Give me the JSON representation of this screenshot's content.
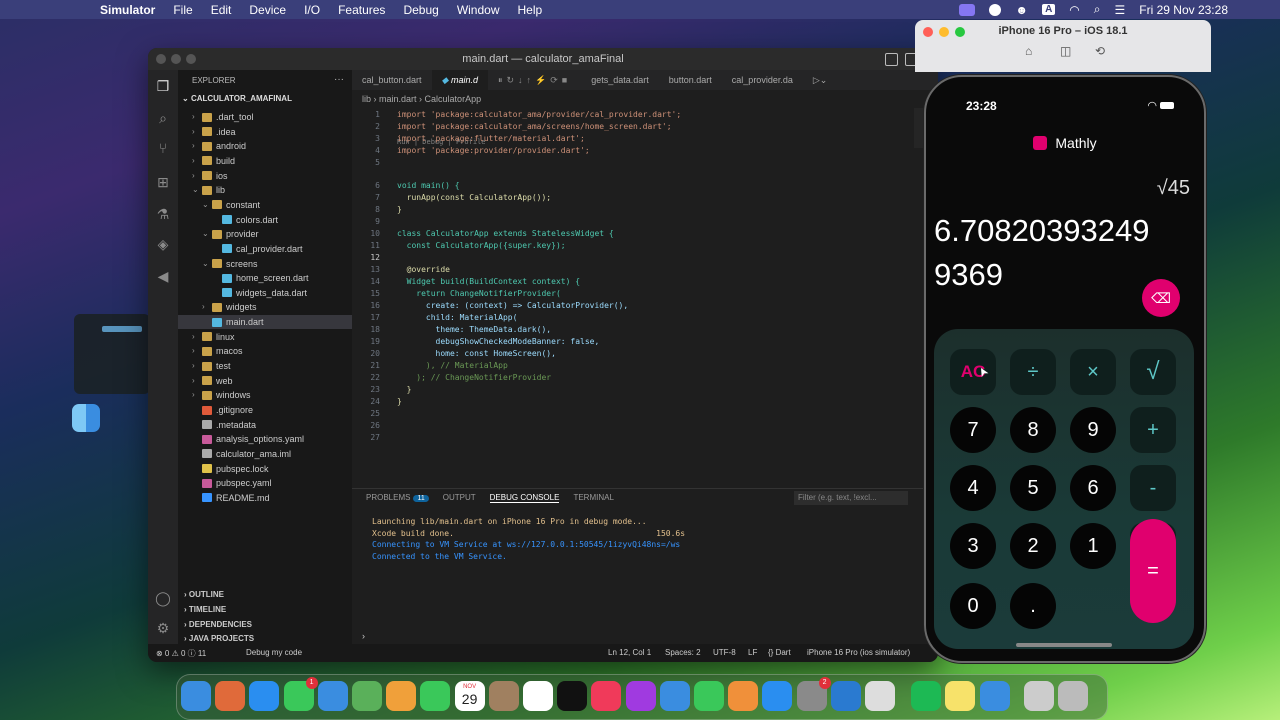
{
  "menubar": {
    "app": "Simulator",
    "items": [
      "File",
      "Edit",
      "Device",
      "I/O",
      "Features",
      "Debug",
      "Window",
      "Help"
    ],
    "datetime": "Fri 29 Nov  23:28",
    "input_source": "A"
  },
  "vscode": {
    "title": "main.dart — calculator_amaFinal",
    "explorer_label": "EXPLORER",
    "root": "CALCULATOR_AMAFINAL",
    "tree": [
      {
        "label": ".dart_tool",
        "type": "folder",
        "depth": 1,
        "open": false
      },
      {
        "label": ".idea",
        "type": "folder",
        "depth": 1,
        "open": false
      },
      {
        "label": "android",
        "type": "folder",
        "depth": 1,
        "open": false
      },
      {
        "label": "build",
        "type": "folder",
        "depth": 1,
        "open": false
      },
      {
        "label": "ios",
        "type": "folder",
        "depth": 1,
        "open": false
      },
      {
        "label": "lib",
        "type": "folder",
        "depth": 1,
        "open": true
      },
      {
        "label": "constant",
        "type": "folder",
        "depth": 2,
        "open": true
      },
      {
        "label": "colors.dart",
        "type": "dart",
        "depth": 3
      },
      {
        "label": "provider",
        "type": "folder",
        "depth": 2,
        "open": true
      },
      {
        "label": "cal_provider.dart",
        "type": "dart",
        "depth": 3
      },
      {
        "label": "screens",
        "type": "folder",
        "depth": 2,
        "open": true
      },
      {
        "label": "home_screen.dart",
        "type": "dart",
        "depth": 3
      },
      {
        "label": "widgets_data.dart",
        "type": "dart",
        "depth": 3
      },
      {
        "label": "widgets",
        "type": "folder",
        "depth": 2,
        "open": false
      },
      {
        "label": "main.dart",
        "type": "dart",
        "depth": 2,
        "selected": true
      },
      {
        "label": "linux",
        "type": "folder",
        "depth": 1,
        "open": false
      },
      {
        "label": "macos",
        "type": "folder",
        "depth": 1,
        "open": false
      },
      {
        "label": "test",
        "type": "folder",
        "depth": 1,
        "open": false
      },
      {
        "label": "web",
        "type": "folder",
        "depth": 1,
        "open": false
      },
      {
        "label": "windows",
        "type": "folder",
        "depth": 1,
        "open": false
      },
      {
        "label": ".gitignore",
        "type": "git",
        "depth": 1
      },
      {
        "label": ".metadata",
        "type": "file",
        "depth": 1
      },
      {
        "label": "analysis_options.yaml",
        "type": "yaml",
        "depth": 1
      },
      {
        "label": "calculator_ama.iml",
        "type": "file",
        "depth": 1
      },
      {
        "label": "pubspec.lock",
        "type": "lock",
        "depth": 1
      },
      {
        "label": "pubspec.yaml",
        "type": "yaml",
        "depth": 1
      },
      {
        "label": "README.md",
        "type": "info",
        "depth": 1
      }
    ],
    "outline_sections": [
      "OUTLINE",
      "TIMELINE",
      "DEPENDENCIES",
      "JAVA PROJECTS"
    ],
    "tabs": [
      "cal_button.dart",
      "main.d",
      "gets_data.dart",
      "button.dart",
      "cal_provider.da"
    ],
    "breadcrumb": [
      "lib",
      "main.dart",
      "CalculatorApp"
    ],
    "code_hint": "Run | Debug | Profile",
    "code": [
      {
        "n": "1",
        "t": "import 'package:calculator_ama/provider/cal_provider.dart';"
      },
      {
        "n": "2",
        "t": "import 'package:calculator_ama/screens/home_screen.dart';"
      },
      {
        "n": "3",
        "t": "import 'package:flutter/material.dart';"
      },
      {
        "n": "4",
        "t": "import 'package:provider/provider.dart';"
      },
      {
        "n": "5",
        "t": ""
      },
      {
        "n": "6",
        "t": "void main() {"
      },
      {
        "n": "7",
        "t": "  runApp(const CalculatorApp());"
      },
      {
        "n": "8",
        "t": "}"
      },
      {
        "n": "9",
        "t": ""
      },
      {
        "n": "10",
        "t": "class CalculatorApp extends StatelessWidget {"
      },
      {
        "n": "11",
        "t": "  const CalculatorApp({super.key});"
      },
      {
        "n": "12",
        "t": ""
      },
      {
        "n": "13",
        "t": "  @override"
      },
      {
        "n": "14",
        "t": "  Widget build(BuildContext context) {"
      },
      {
        "n": "15",
        "t": "    return ChangeNotifierProvider("
      },
      {
        "n": "16",
        "t": "      create: (context) => CalculatorProvider(),"
      },
      {
        "n": "17",
        "t": "      child: MaterialApp("
      },
      {
        "n": "18",
        "t": "        theme: ThemeData.dark(),"
      },
      {
        "n": "19",
        "t": "        debugShowCheckedModeBanner: false,"
      },
      {
        "n": "20",
        "t": "        home: const HomeScreen(),"
      },
      {
        "n": "21",
        "t": "      ), // MaterialApp"
      },
      {
        "n": "22",
        "t": "    ); // ChangeNotifierProvider"
      },
      {
        "n": "23",
        "t": "  }"
      },
      {
        "n": "24",
        "t": "}"
      },
      {
        "n": "25",
        "t": ""
      },
      {
        "n": "26",
        "t": ""
      },
      {
        "n": "27",
        "t": ""
      }
    ],
    "panel": {
      "tabs": [
        "PROBLEMS",
        "OUTPUT",
        "DEBUG CONSOLE",
        "TERMINAL"
      ],
      "problems_count": "11",
      "filter_placeholder": "Filter (e.g. text, !excl...",
      "console": [
        {
          "text": "Launching lib/main.dart on iPhone 16 Pro in debug mode...",
          "color": "#e2c08d"
        },
        {
          "text": "Xcode build done.                                          150.6s",
          "color": "#e2c08d"
        },
        {
          "text": "Connecting to VM Service at ws://127.0.0.1:50545/1izyvQi48ns=/ws",
          "color": "#3794ff"
        },
        {
          "text": "Connected to the VM Service.",
          "color": "#3794ff"
        }
      ]
    },
    "status": {
      "problems": "⊗ 0 ⚠ 0 ⓘ 11",
      "debug": "Debug my code",
      "position": "Ln 12, Col 1",
      "spaces": "Spaces: 2",
      "encoding": "UTF-8",
      "eol": "LF",
      "language": "{} Dart",
      "device": "iPhone 16 Pro (ios simulator)"
    }
  },
  "simulator": {
    "title": "iPhone 16 Pro – iOS 18.1",
    "time": "23:28",
    "app_name": "Mathly",
    "expression": "√45",
    "result_line1": "6.70820393249",
    "result_line2": "9369",
    "accent": "#e0006e",
    "keys": [
      {
        "label": "AC",
        "kind": "op-ac"
      },
      {
        "label": "÷",
        "kind": "op"
      },
      {
        "label": "×",
        "kind": "op"
      },
      {
        "label": "√",
        "kind": "op"
      },
      {
        "label": "7",
        "kind": "num"
      },
      {
        "label": "8",
        "kind": "num"
      },
      {
        "label": "9",
        "kind": "num"
      },
      {
        "label": "+",
        "kind": "op"
      },
      {
        "label": "4",
        "kind": "num"
      },
      {
        "label": "5",
        "kind": "num"
      },
      {
        "label": "6",
        "kind": "num"
      },
      {
        "label": "-",
        "kind": "op"
      },
      {
        "label": "3",
        "kind": "num"
      },
      {
        "label": "2",
        "kind": "num"
      },
      {
        "label": "1",
        "kind": "num"
      },
      {
        "label": "%",
        "kind": "num"
      },
      {
        "label": "0",
        "kind": "num"
      },
      {
        "label": ".",
        "kind": "num"
      },
      {
        "label": "=",
        "kind": "equals"
      }
    ]
  },
  "dock": {
    "calendar_month": "NOV",
    "calendar_day": "29",
    "messages_badge": "1",
    "settings_badge": "2"
  }
}
